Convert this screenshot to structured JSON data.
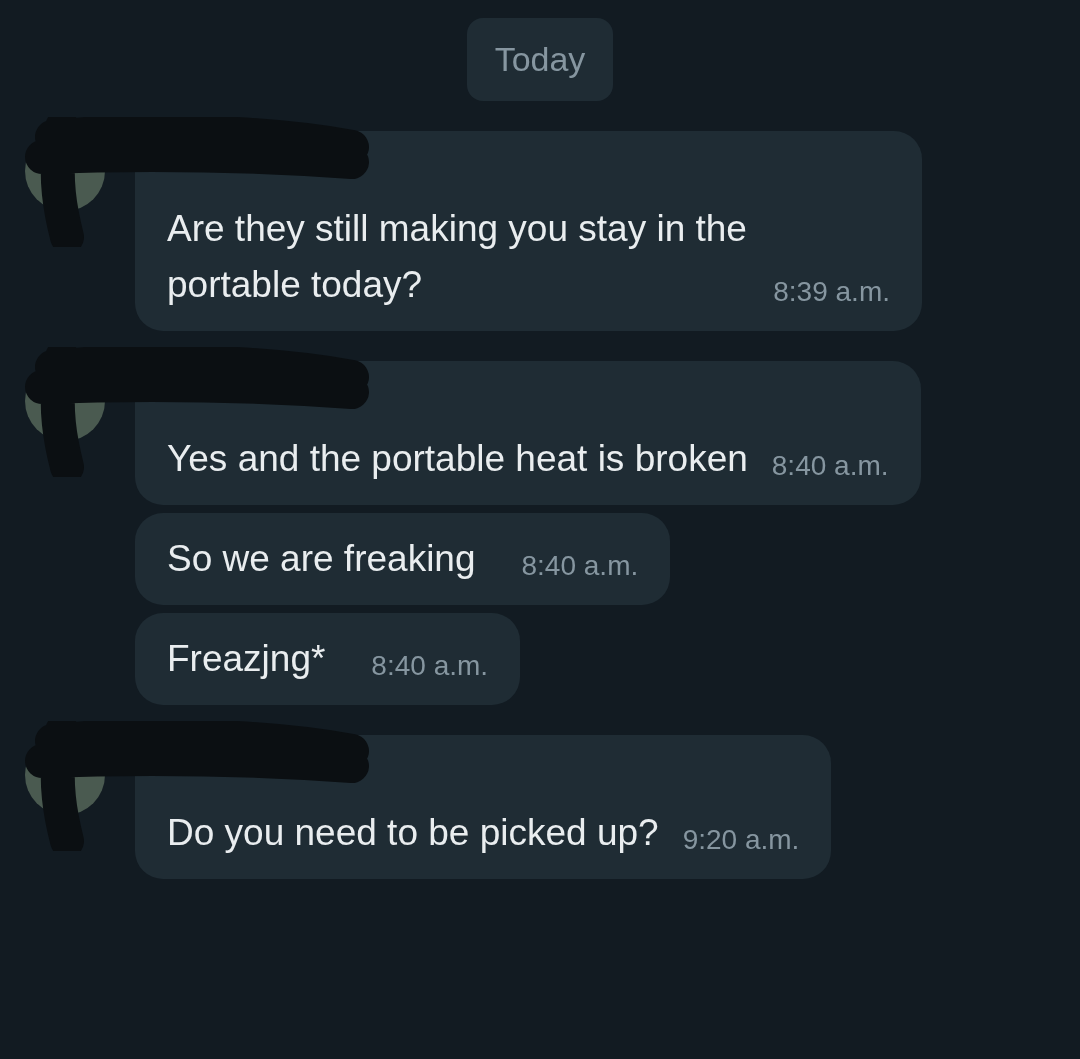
{
  "date_chip": "Today",
  "messages": [
    {
      "first": true,
      "text": "Are they still making you stay in the portable today?",
      "time": "8:39 a.m."
    },
    {
      "first": true,
      "text": "Yes and the portable heat is broken",
      "time": "8:40 a.m."
    },
    {
      "first": false,
      "text": "So we are freaking",
      "time": "8:40 a.m."
    },
    {
      "first": false,
      "text": "Freazjng*",
      "time": "8:40 a.m."
    },
    {
      "first": true,
      "text": "Do you need to be picked up?",
      "time": "9:20 a.m."
    }
  ]
}
